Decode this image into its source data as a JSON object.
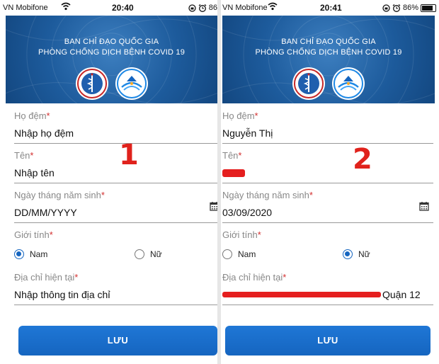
{
  "panels": [
    {
      "status": {
        "carrier": "VN Mobifone",
        "time": "20:40",
        "battery": "86"
      },
      "banner": {
        "line1": "BAN CHỈ ĐẠO QUỐC GIA",
        "line2": "PHÒNG CHỐNG DỊCH BỆNH COVID 19"
      },
      "step_number": "1",
      "fields": {
        "surname": {
          "label": "Họ đệm",
          "value": "Nhập họ đệm"
        },
        "name": {
          "label": "Tên",
          "value": "Nhập tên"
        },
        "dob": {
          "label": "Ngày tháng năm sinh",
          "value": "DD/MM/YYYY"
        },
        "gender": {
          "label": "Giới tính",
          "option_male": "Nam",
          "option_female": "Nữ",
          "selected": "Nam"
        },
        "address": {
          "label": "Địa chỉ hiện tại",
          "value": "Nhập thông tin địa chỉ"
        }
      },
      "save_label": "LƯU"
    },
    {
      "status": {
        "carrier": "VN Mobifone",
        "time": "20:41",
        "battery": "86%"
      },
      "banner": {
        "line1": "BAN CHỈ ĐẠO QUỐC GIA",
        "line2": "PHÒNG CHỐNG DỊCH BỆNH COVID 19"
      },
      "step_number": "2",
      "fields": {
        "surname": {
          "label": "Họ đệm",
          "value": "Nguyễn Thị"
        },
        "name": {
          "label": "Tên",
          "value": ""
        },
        "dob": {
          "label": "Ngày tháng năm sinh",
          "value": "03/09/2020"
        },
        "gender": {
          "label": "Giới tính",
          "option_male": "Nam",
          "option_female": "Nữ",
          "selected": "Nữ"
        },
        "address": {
          "label": "Địa chỉ hiện tại",
          "value": "Quận 12"
        }
      },
      "save_label": "LƯU"
    }
  ],
  "required_mark": "*",
  "colors": {
    "banner": "#1d5b9c",
    "button": "#1565c0",
    "required": "#d32f2f",
    "step_number": "#e0221c",
    "redaction": "#e51f1f"
  }
}
